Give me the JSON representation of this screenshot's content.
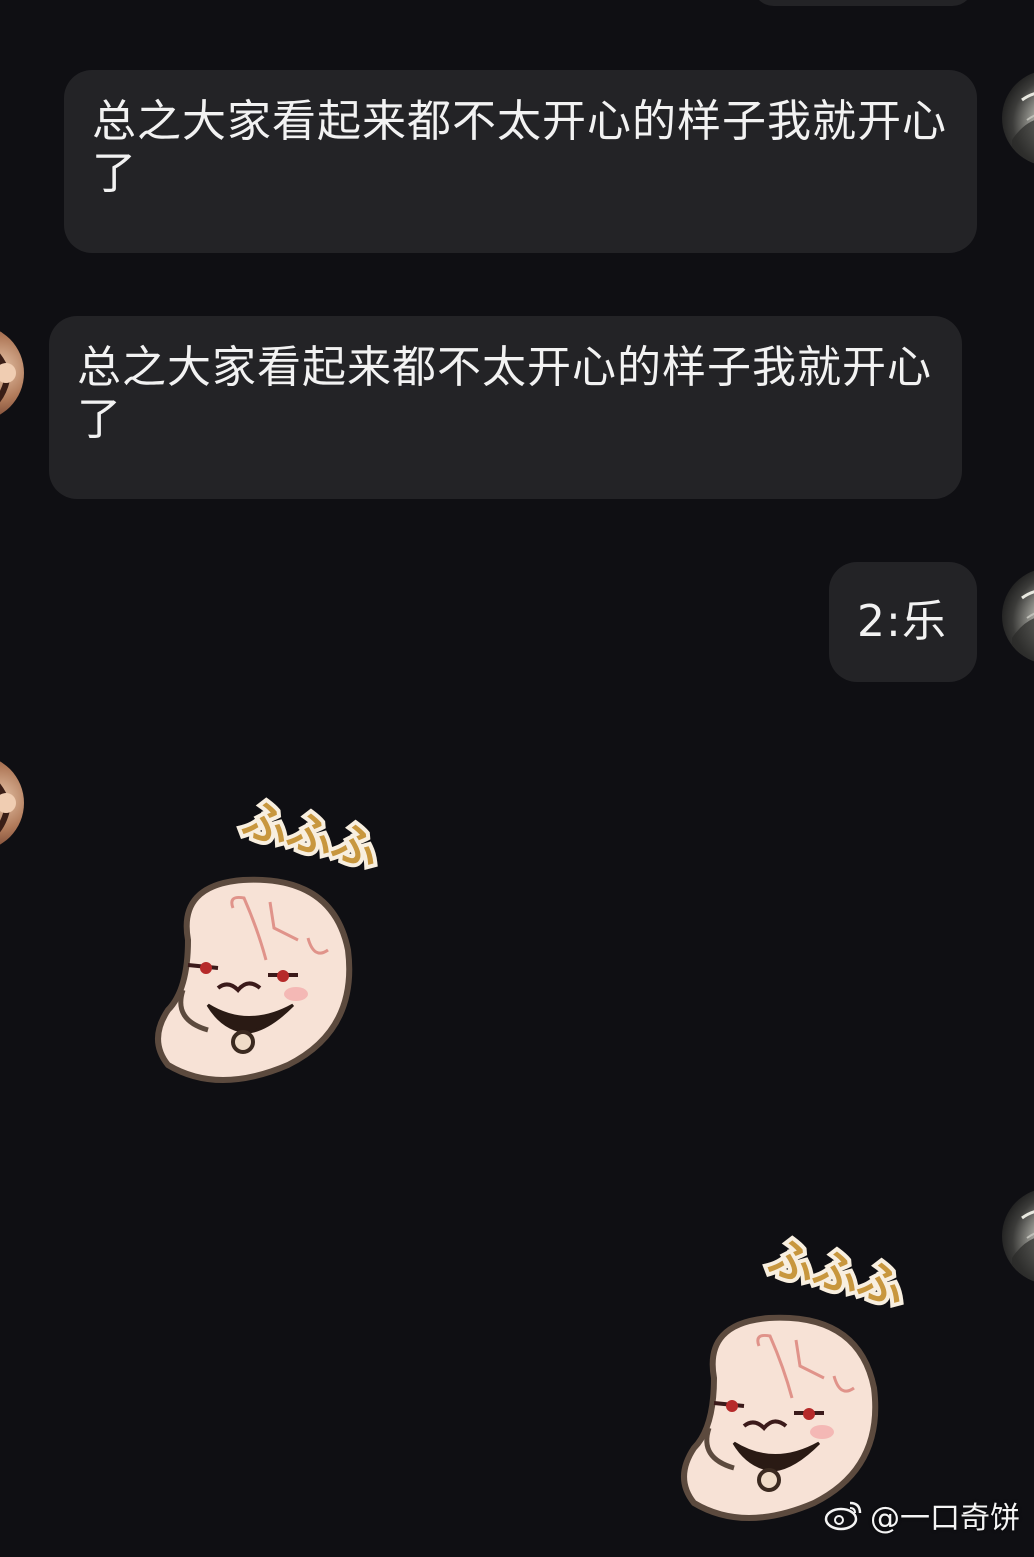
{
  "messages": [
    {
      "side": "right",
      "text": "总之大家看起来都不太开心的样子我就开心了"
    },
    {
      "side": "left",
      "text": "总之大家看起来都不太开心的样子我就开心了"
    },
    {
      "side": "right",
      "text": "2:乐"
    }
  ],
  "stickers": [
    {
      "side": "left",
      "caption": "ふふふ"
    },
    {
      "side": "right",
      "caption": "ふふふ"
    }
  ],
  "watermark": {
    "handle": "@一口奇饼",
    "icon": "weibo-icon"
  },
  "colors": {
    "background": "#0f0f13",
    "bubble": "#232326",
    "text": "#f2f2f2"
  }
}
